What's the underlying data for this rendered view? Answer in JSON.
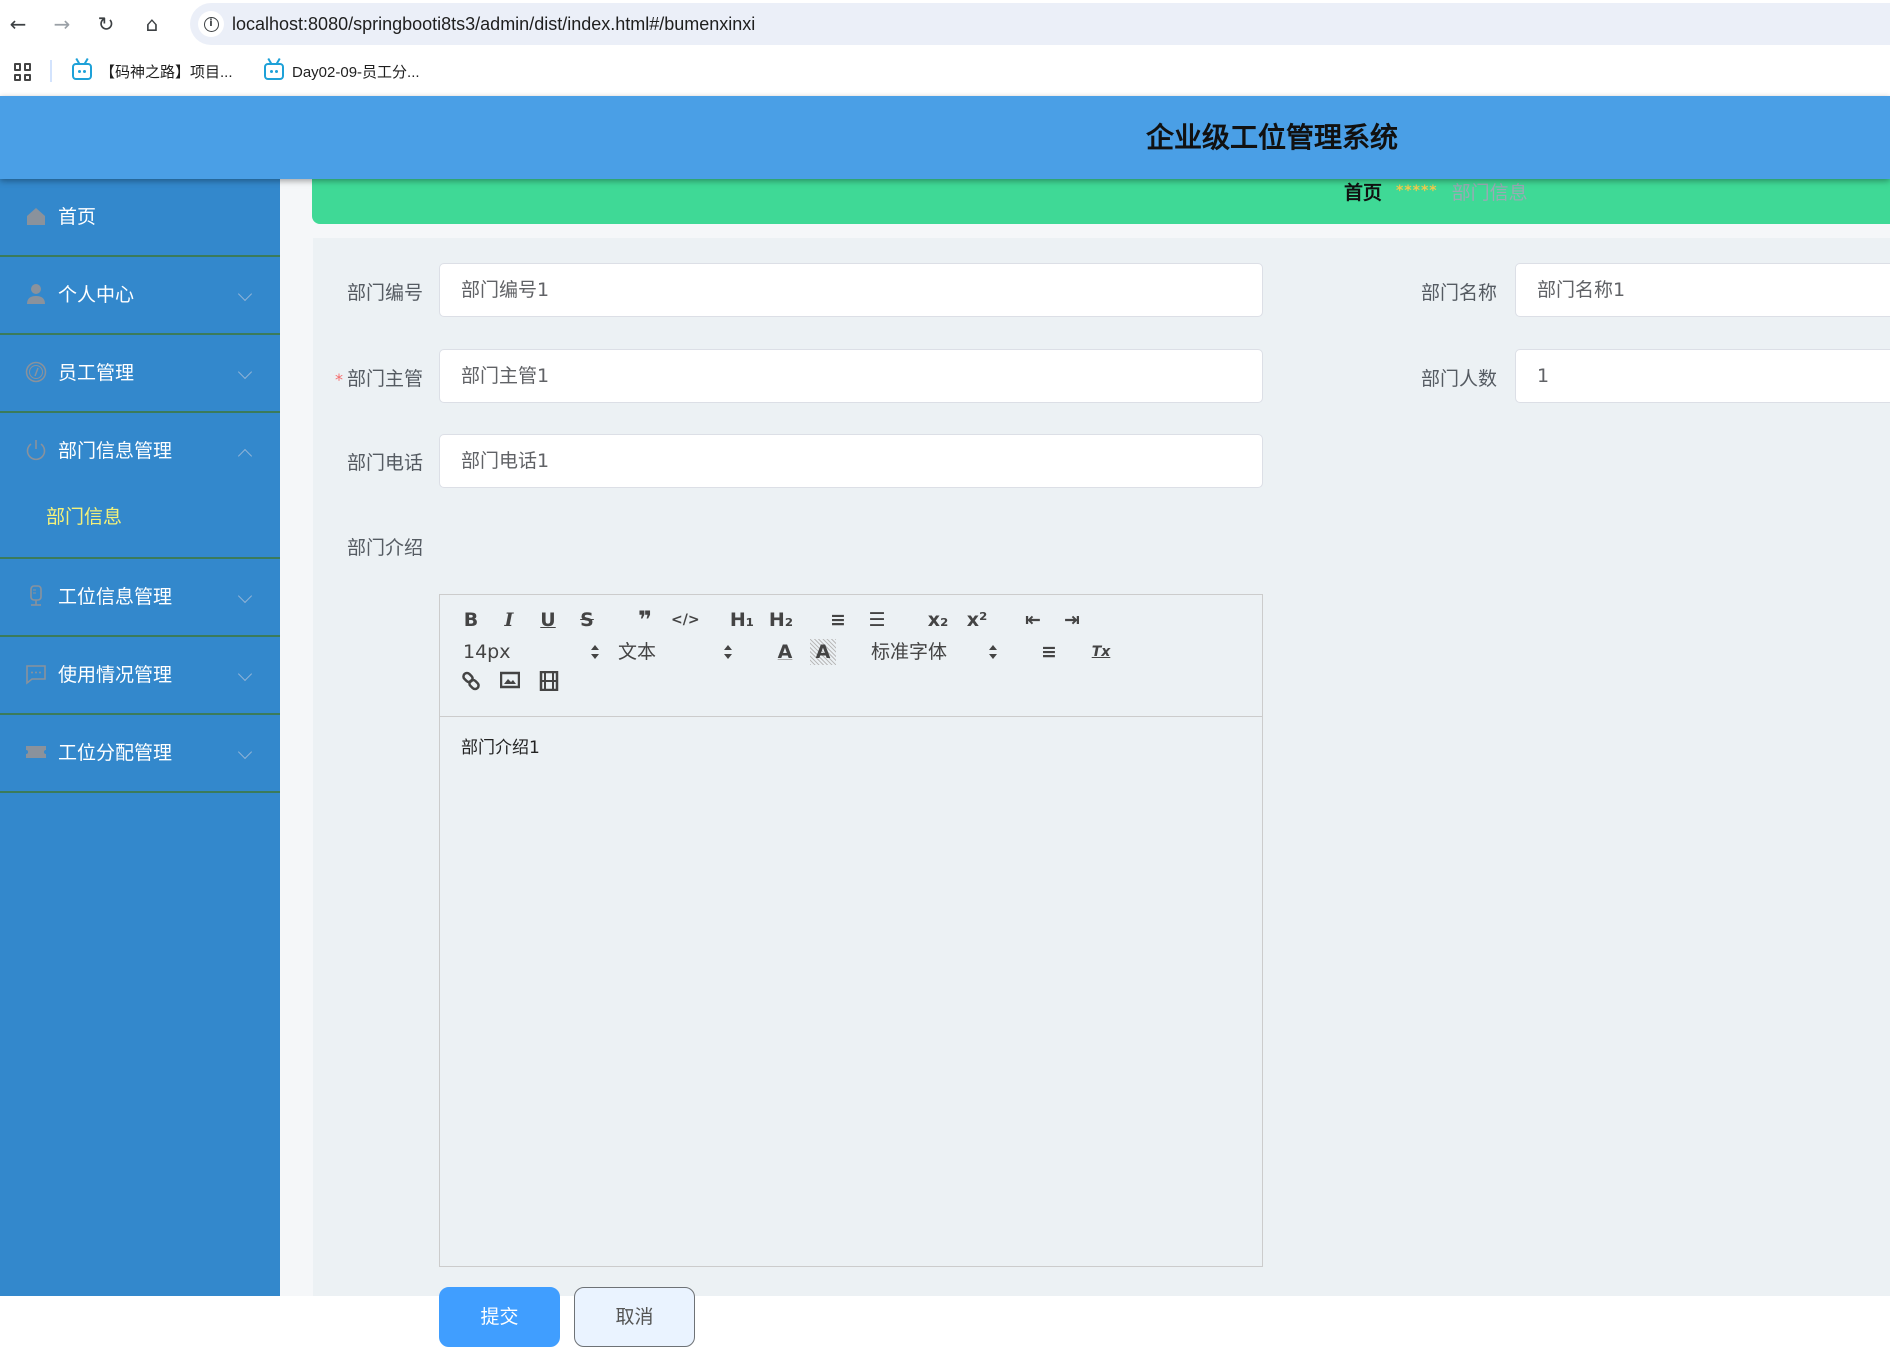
{
  "browser": {
    "url": "localhost:8080/springbooti8ts3/admin/dist/index.html#/bumenxinxi",
    "bookmarks": [
      {
        "label": "【码神之路】项目...",
        "icon": "bilibili-tv-icon"
      },
      {
        "label": "Day02-09-员工分...",
        "icon": "bilibili-tv-icon"
      }
    ]
  },
  "header": {
    "title": "企业级工位管理系统"
  },
  "sidebar": {
    "items": [
      {
        "label": "首页",
        "icon": "home-icon",
        "expandable": false
      },
      {
        "label": "个人中心",
        "icon": "user-icon",
        "expandable": true,
        "expanded": false
      },
      {
        "label": "员工管理",
        "icon": "gauge-icon",
        "expandable": true,
        "expanded": false
      },
      {
        "label": "部门信息管理",
        "icon": "power-icon",
        "expandable": true,
        "expanded": true,
        "children": [
          {
            "label": "部门信息",
            "active": true
          }
        ]
      },
      {
        "label": "工位信息管理",
        "icon": "microphone-icon",
        "expandable": true,
        "expanded": false
      },
      {
        "label": "使用情况管理",
        "icon": "chat-icon",
        "expandable": true,
        "expanded": false
      },
      {
        "label": "工位分配管理",
        "icon": "ticket-icon",
        "expandable": true,
        "expanded": false
      }
    ]
  },
  "breadcrumb": {
    "home": "首页",
    "separator": "*****",
    "current": "部门信息"
  },
  "form": {
    "fields": {
      "dept_no": {
        "label": "部门编号",
        "value": "部门编号1",
        "required": false
      },
      "dept_name": {
        "label": "部门名称",
        "value": "部门名称1",
        "required": false
      },
      "dept_manager": {
        "label": "部门主管",
        "value": "部门主管1",
        "required": true,
        "required_mark": "*"
      },
      "dept_count": {
        "label": "部门人数",
        "value": "1",
        "required": false
      },
      "dept_phone": {
        "label": "部门电话",
        "value": "部门电话1",
        "required": false
      },
      "dept_intro": {
        "label": "部门介绍",
        "value": "部门介绍1"
      }
    },
    "editor": {
      "font_size": "14px",
      "header_select": "文本",
      "font_family": "标准字体",
      "tools": {
        "bold": "B",
        "italic": "I",
        "underline": "U",
        "strike": "S",
        "blockquote": "❞",
        "code": "</>",
        "h1": "H₁",
        "h2": "H₂",
        "ordered_list": "≡",
        "bullet_list": "☰",
        "subscript": "x₂",
        "superscript": "x²",
        "outdent": "⇤",
        "indent": "⇥",
        "color": "A",
        "background": "A",
        "align": "≡",
        "clean": "Tx",
        "link": "🔗",
        "image": "▣",
        "video": "▦"
      }
    },
    "submit_label": "提交",
    "cancel_label": "取消"
  },
  "colors": {
    "header": "#4a9fe6",
    "sidebar": "#3388cc",
    "breadcrumb_bg": "#3fd996",
    "submenu_active": "#f4f17a",
    "primary": "#409eff",
    "required": "#f56c6c"
  }
}
